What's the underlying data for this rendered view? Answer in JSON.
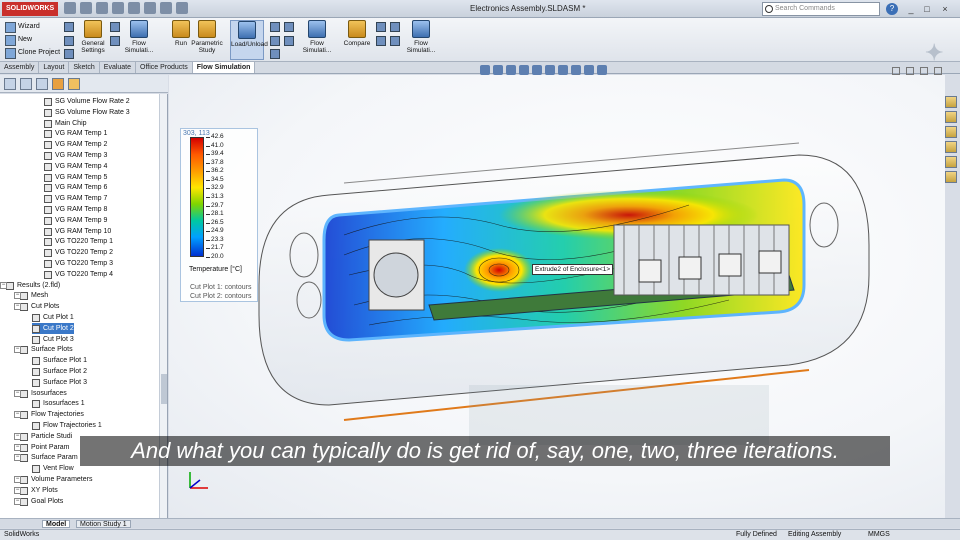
{
  "app": {
    "logo_text": "SOLIDWORKS",
    "document_title": "Electronics Assembly.SLDASM *",
    "search_placeholder": "Search Commands",
    "help_label": "?",
    "min_label": "_",
    "max_label": "□",
    "close_label": "×"
  },
  "ribbon": {
    "left_items": [
      "Wizard",
      "New",
      "Clone Project"
    ],
    "buttons": [
      {
        "label": "General Settings"
      },
      {
        "label": "Flow Simulati..."
      },
      {
        "label": "Run"
      },
      {
        "label": "Parametric Study"
      },
      {
        "label": "Load/Unload"
      },
      {
        "label": "Flow Simulati..."
      },
      {
        "label": "Compare"
      },
      {
        "label": "Flow Simulati..."
      }
    ]
  },
  "command_tabs": [
    "Assembly",
    "Layout",
    "Sketch",
    "Evaluate",
    "Office Products",
    "Flow Simulation"
  ],
  "tree": {
    "items": [
      {
        "label": "SG Volume Flow Rate 2",
        "level": 3
      },
      {
        "label": "SG Volume Flow Rate 3",
        "level": 3
      },
      {
        "label": "Main Chip",
        "level": 3
      },
      {
        "label": "VG RAM Temp 1",
        "level": 3
      },
      {
        "label": "VG RAM Temp 2",
        "level": 3
      },
      {
        "label": "VG RAM Temp 3",
        "level": 3
      },
      {
        "label": "VG RAM Temp 4",
        "level": 3
      },
      {
        "label": "VG RAM Temp 5",
        "level": 3
      },
      {
        "label": "VG RAM Temp 6",
        "level": 3
      },
      {
        "label": "VG RAM Temp 7",
        "level": 3
      },
      {
        "label": "VG RAM Temp 8",
        "level": 3
      },
      {
        "label": "VG RAM Temp 9",
        "level": 3
      },
      {
        "label": "VG RAM Temp 10",
        "level": 3
      },
      {
        "label": "VG TO220 Temp 1",
        "level": 3
      },
      {
        "label": "VG TO220 Temp 2",
        "level": 3
      },
      {
        "label": "VG TO220 Temp 3",
        "level": 3
      },
      {
        "label": "VG TO220 Temp 4",
        "level": 3
      },
      {
        "label": "Results (2.fld)",
        "level": 0
      },
      {
        "label": "Mesh",
        "level": 1
      },
      {
        "label": "Cut Plots",
        "level": 1
      },
      {
        "label": "Cut Plot 1",
        "level": 2
      },
      {
        "label": "Cut Plot 2",
        "level": 2
      },
      {
        "label": "Cut Plot 3",
        "level": 2
      },
      {
        "label": "Surface Plots",
        "level": 1
      },
      {
        "label": "Surface Plot 1",
        "level": 2
      },
      {
        "label": "Surface Plot 2",
        "level": 2
      },
      {
        "label": "Surface Plot 3",
        "level": 2
      },
      {
        "label": "Isosurfaces",
        "level": 1
      },
      {
        "label": "Isosurfaces 1",
        "level": 2
      },
      {
        "label": "Flow Trajectories",
        "level": 1
      },
      {
        "label": "Flow Trajectories 1",
        "level": 2
      },
      {
        "label": "Particle Studi",
        "level": 1
      },
      {
        "label": "Point Param",
        "level": 1
      },
      {
        "label": "Surface Param",
        "level": 1
      },
      {
        "label": "Vent Flow",
        "level": 2
      },
      {
        "label": "Volume Parameters",
        "level": 1
      },
      {
        "label": "XY Plots",
        "level": 1
      },
      {
        "label": "Goal Plots",
        "level": 1
      }
    ],
    "selected_index": 21
  },
  "legend": {
    "coord": "303, 113",
    "ticks": [
      "42.6",
      "41.0",
      "39.4",
      "37.8",
      "36.2",
      "34.5",
      "32.9",
      "31.3",
      "29.7",
      "28.1",
      "26.5",
      "24.9",
      "23.3",
      "21.7",
      "20.0"
    ],
    "title": "Temperature [°C]",
    "note1": "Cut Plot 1: contours",
    "note2": "Cut Plot 2: contours"
  },
  "callout": "Extrude2 of Enclosure<1>",
  "caption": "And what you can typically do is get rid of, say, one, two, three iterations.",
  "bottom_tabs": [
    "Model",
    "Motion Study 1"
  ],
  "status": {
    "app": "SolidWorks",
    "state": "Fully Defined",
    "mode": "Editing Assembly",
    "units": "MMGS"
  }
}
